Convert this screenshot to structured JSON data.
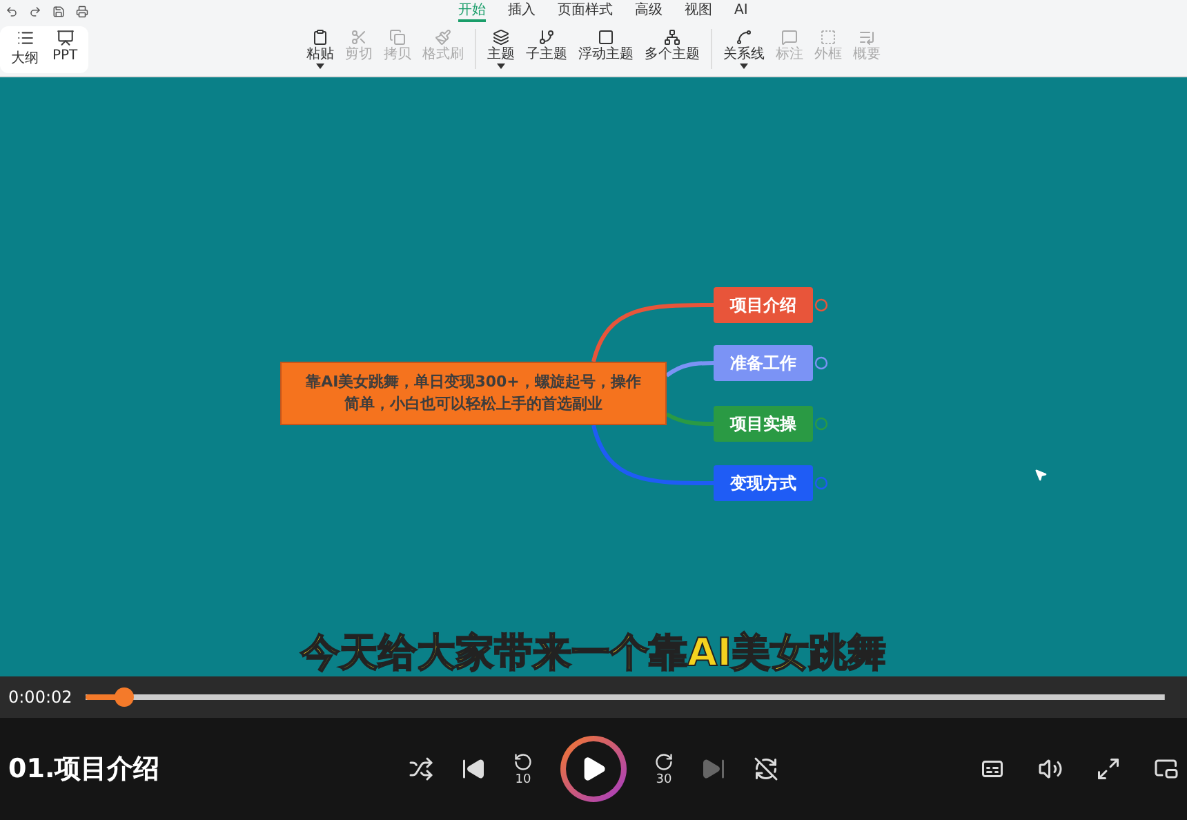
{
  "menu_tabs": [
    {
      "label": "开始",
      "selected": true
    },
    {
      "label": "插入",
      "selected": false
    },
    {
      "label": "页面样式",
      "selected": false
    },
    {
      "label": "高级",
      "selected": false
    },
    {
      "label": "视图",
      "selected": false
    },
    {
      "label": "AI",
      "selected": false
    }
  ],
  "side_panel": {
    "items": [
      {
        "label": "大纲"
      },
      {
        "label": "PPT"
      }
    ]
  },
  "toolbar": {
    "groups": [
      [
        {
          "label": "粘贴",
          "disabled": false,
          "dropdown": true
        },
        {
          "label": "剪切",
          "disabled": true,
          "dropdown": false
        },
        {
          "label": "拷贝",
          "disabled": true,
          "dropdown": false
        },
        {
          "label": "格式刷",
          "disabled": true,
          "dropdown": false
        }
      ],
      [
        {
          "label": "主题",
          "disabled": false,
          "dropdown": true
        },
        {
          "label": "子主题",
          "disabled": false,
          "dropdown": false
        },
        {
          "label": "浮动主题",
          "disabled": false,
          "dropdown": false
        },
        {
          "label": "多个主题",
          "disabled": false,
          "dropdown": false
        }
      ],
      [
        {
          "label": "关系线",
          "disabled": false,
          "dropdown": true
        },
        {
          "label": "标注",
          "disabled": true,
          "dropdown": false
        },
        {
          "label": "外框",
          "disabled": true,
          "dropdown": false
        },
        {
          "label": "概要",
          "disabled": true,
          "dropdown": false
        }
      ]
    ]
  },
  "mind_map": {
    "root": "靠AI美女跳舞，单日变现300+，螺旋起号，操作简单，小白也可以轻松上手的首选副业",
    "branches": [
      {
        "label": "项目介绍",
        "color": "#e8553a"
      },
      {
        "label": "准备工作",
        "color": "#7b93f5"
      },
      {
        "label": "项目实操",
        "color": "#2a9a44"
      },
      {
        "label": "变现方式",
        "color": "#1f5cf5"
      }
    ]
  },
  "subtitle": "今天给大家带来一个靠AI美女跳舞",
  "player": {
    "time": "0:00:02",
    "progress": {
      "level": 0.035
    },
    "title": "01.项目介绍",
    "playing": false,
    "rewind_label": "10",
    "forward_label": "30"
  }
}
